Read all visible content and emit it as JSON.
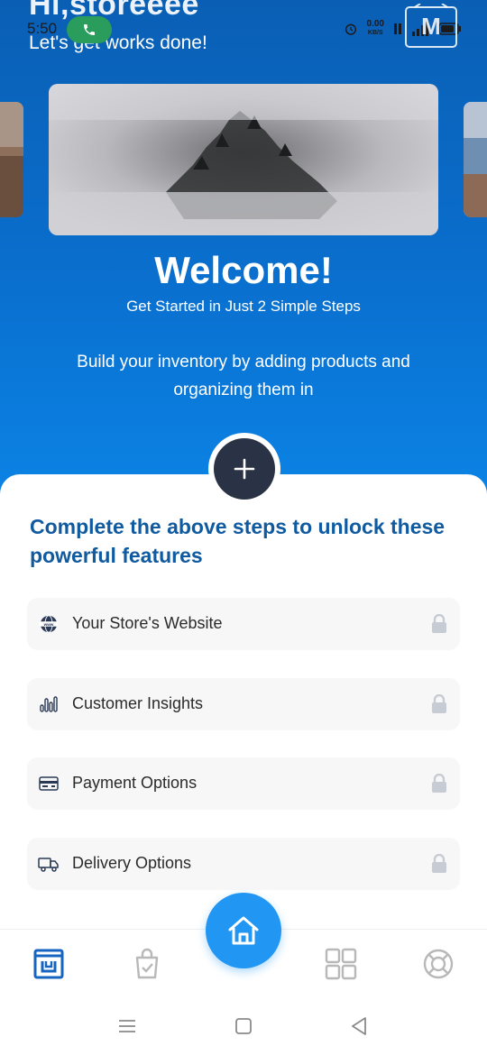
{
  "status_bar": {
    "time": "5:50",
    "net_speed_value": "0.00",
    "net_speed_unit": "KB/S"
  },
  "header": {
    "greeting": "Hi,storeeee",
    "subtitle": "Let's get works done!"
  },
  "welcome": {
    "title": "Welcome!",
    "subtitle": "Get Started in Just 2 Simple Steps",
    "description": "Build your inventory by adding products and organizing them in"
  },
  "add_button": {
    "icon": "plus-icon",
    "label": "+"
  },
  "unlock_heading": "Complete the above steps to unlock  these powerful features",
  "features": [
    {
      "label": "Your Store's Website",
      "icon": "globe-www-icon",
      "locked": true
    },
    {
      "label": "Customer Insights",
      "icon": "bar-chart-icon",
      "locked": true
    },
    {
      "label": "Payment Options",
      "icon": "credit-card-icon",
      "locked": true
    },
    {
      "label": "Delivery Options",
      "icon": "delivery-truck-icon",
      "locked": true
    }
  ],
  "bottom_nav": {
    "items": [
      {
        "icon": "store-icon",
        "active": true
      },
      {
        "icon": "shopping-bag-check-icon",
        "active": false
      },
      {
        "icon": "home-icon",
        "active": true
      },
      {
        "icon": "grid-icon",
        "active": false
      },
      {
        "icon": "support-lifebuoy-icon",
        "active": false
      }
    ]
  },
  "colors": {
    "hero_top": "#0a5fb4",
    "hero_bottom": "#0b84e6",
    "heading": "#105aa0",
    "fab": "#2196f3",
    "plus_button": "#2a3245",
    "active_nav": "#1565c0",
    "inactive_nav": "#b8b8b8",
    "lock": "#c7ccd4"
  }
}
